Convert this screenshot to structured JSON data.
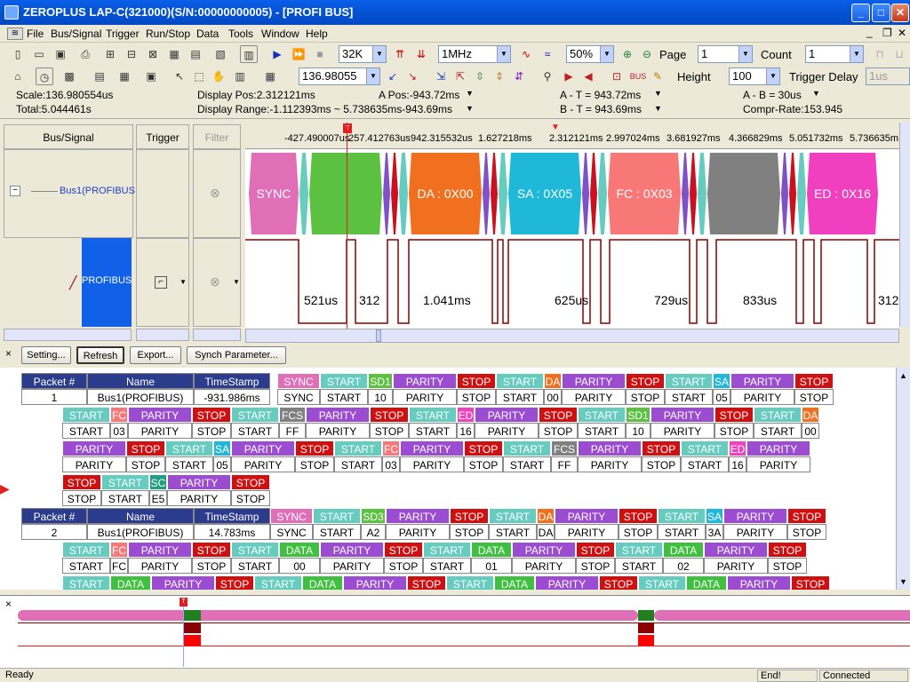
{
  "window": {
    "title": "ZEROPLUS LAP-C(321000)(S/N:00000000005) - [PROFI BUS]",
    "min": "_",
    "max": "□",
    "close": "✕"
  },
  "menu": [
    "File",
    "Bus/Signal",
    "Trigger",
    "Run/Stop",
    "Data",
    "Tools",
    "Window",
    "Help"
  ],
  "toolbar1": {
    "memory": "32K",
    "rate": "1MHz",
    "zoom": "50%",
    "page_label": "Page",
    "page": "1",
    "count_label": "Count",
    "count": "1"
  },
  "toolbar2": {
    "position": "136.98055",
    "height_label": "Height",
    "height": "100",
    "trigger_delay_label": "Trigger Delay",
    "delay_value": "1us"
  },
  "info": {
    "scale": "Scale:136.980554us",
    "total": "Total:5.044461s",
    "display_pos": "Display Pos:2.312121ms",
    "display_range": "Display Range:-1.112393ms ~ 5.738635ms-943.69ms",
    "a_pos": "A Pos:-943.72ms",
    "a_t": "A - T = 943.72ms",
    "b_t": "B - T = 943.69ms",
    "a_b": "A - B = 30us",
    "compr": "Compr-Rate:153.945"
  },
  "columns": {
    "bus_signal": "Bus/Signal",
    "trigger": "Trigger",
    "filter": "Filter"
  },
  "signals": {
    "bus": "Bus1(PROFIBUS",
    "channel": "PROFIBUS"
  },
  "ruler": [
    "-427.490007us",
    "257.412763us",
    "942.315532us",
    "1.627218ms",
    "2.312121ms",
    "2.997024ms",
    "3.681927ms",
    "4.366829ms",
    "5.051732ms",
    "5.736635m"
  ],
  "bus_segments": [
    {
      "label": "SYNC",
      "color": "#e06fb8",
      "w": 56
    },
    {
      "label": "",
      "color": "#66ccc0",
      "w": 10
    },
    {
      "label": "",
      "color": "#5cc040",
      "w": 82
    },
    {
      "label": "",
      "color": "#8050c8",
      "w": 8
    },
    {
      "label": "",
      "color": "#cc1020",
      "w": 8
    },
    {
      "label": "",
      "color": "#66ccc0",
      "w": 10
    },
    {
      "label": "DA : 0X00",
      "color": "#f07020",
      "w": 82
    },
    {
      "label": "",
      "color": "#8050c8",
      "w": 8
    },
    {
      "label": "",
      "color": "#cc1020",
      "w": 8
    },
    {
      "label": "",
      "color": "#66ccc0",
      "w": 10
    },
    {
      "label": "SA : 0X05",
      "color": "#20b8d8",
      "w": 82
    },
    {
      "label": "",
      "color": "#8050c8",
      "w": 8
    },
    {
      "label": "",
      "color": "#cc1020",
      "w": 8
    },
    {
      "label": "",
      "color": "#66ccc0",
      "w": 10
    },
    {
      "label": "FC : 0X03",
      "color": "#f87878",
      "w": 82
    },
    {
      "label": "",
      "color": "#8050c8",
      "w": 8
    },
    {
      "label": "",
      "color": "#cc1020",
      "w": 8
    },
    {
      "label": "",
      "color": "#66ccc0",
      "w": 10
    },
    {
      "label": "",
      "color": "#808080",
      "w": 82
    },
    {
      "label": "",
      "color": "#8050c8",
      "w": 8
    },
    {
      "label": "",
      "color": "#cc1020",
      "w": 8
    },
    {
      "label": "",
      "color": "#66ccc0",
      "w": 10
    },
    {
      "label": "ED : 0X16",
      "color": "#f040c0",
      "w": 80
    }
  ],
  "durations": [
    "521us",
    "312",
    "1.041ms",
    "625us",
    "729us",
    "833us",
    "312"
  ],
  "buttons": {
    "setting": "Setting...",
    "refresh": "Refresh",
    "export": "Export...",
    "synch": "Synch Parameter..."
  },
  "packet_headers": {
    "packet": "Packet #",
    "name": "Name",
    "timestamp": "TimeStamp"
  },
  "packets": [
    {
      "num": "1",
      "name": "Bus1(PROFIBUS)",
      "ts": "-931.986ms"
    },
    {
      "num": "2",
      "name": "Bus1(PROFIBUS)",
      "ts": "14.783ms"
    }
  ],
  "rows": [
    [
      [
        "SYNC",
        "SYNC"
      ],
      [
        "START",
        "START"
      ],
      [
        "SD1",
        "10"
      ],
      [
        "PARITY",
        "PARITY"
      ],
      [
        "STOP",
        "STOP"
      ],
      [
        "START",
        "START"
      ],
      [
        "DA",
        "00"
      ],
      [
        "PARITY",
        "PARITY"
      ],
      [
        "STOP",
        "STOP"
      ],
      [
        "START",
        "START"
      ],
      [
        "SA",
        "05"
      ],
      [
        "PARITY",
        "PARITY"
      ],
      [
        "STOP",
        "STOP"
      ]
    ],
    [
      [
        "START",
        "START"
      ],
      [
        "FC",
        "03"
      ],
      [
        "PARITY",
        "PARITY"
      ],
      [
        "STOP",
        "STOP"
      ],
      [
        "START",
        "START"
      ],
      [
        "FCS",
        "FF"
      ],
      [
        "PARITY",
        "PARITY"
      ],
      [
        "STOP",
        "STOP"
      ],
      [
        "START",
        "START"
      ],
      [
        "ED",
        "16"
      ],
      [
        "PARITY",
        "PARITY"
      ],
      [
        "STOP",
        "STOP"
      ],
      [
        "START",
        "START"
      ],
      [
        "SD1",
        "10"
      ],
      [
        "PARITY",
        "PARITY"
      ],
      [
        "STOP",
        "STOP"
      ],
      [
        "START",
        "START"
      ],
      [
        "DA",
        "00"
      ]
    ],
    [
      [
        "PARITY",
        "PARITY"
      ],
      [
        "STOP",
        "STOP"
      ],
      [
        "START",
        "START"
      ],
      [
        "SA",
        "05"
      ],
      [
        "PARITY",
        "PARITY"
      ],
      [
        "STOP",
        "STOP"
      ],
      [
        "START",
        "START"
      ],
      [
        "FC",
        "03"
      ],
      [
        "PARITY",
        "PARITY"
      ],
      [
        "STOP",
        "STOP"
      ],
      [
        "START",
        "START"
      ],
      [
        "FCS",
        "FF"
      ],
      [
        "PARITY",
        "PARITY"
      ],
      [
        "STOP",
        "STOP"
      ],
      [
        "START",
        "START"
      ],
      [
        "ED",
        "16"
      ],
      [
        "PARITY",
        "PARITY"
      ]
    ],
    [
      [
        "STOP",
        "STOP"
      ],
      [
        "START",
        "START"
      ],
      [
        "SC",
        "E5"
      ],
      [
        "PARITY",
        "PARITY"
      ],
      [
        "STOP",
        "STOP"
      ]
    ],
    [
      [
        "SYNC",
        "SYNC"
      ],
      [
        "START",
        "START"
      ],
      [
        "SD3",
        "A2"
      ],
      [
        "PARITY",
        "PARITY"
      ],
      [
        "STOP",
        "STOP"
      ],
      [
        "START",
        "START"
      ],
      [
        "DA",
        "DA"
      ],
      [
        "PARITY",
        "PARITY"
      ],
      [
        "STOP",
        "STOP"
      ],
      [
        "START",
        "START"
      ],
      [
        "SA",
        "3A"
      ],
      [
        "PARITY",
        "PARITY"
      ],
      [
        "STOP",
        "STOP"
      ]
    ],
    [
      [
        "START",
        "START"
      ],
      [
        "FC",
        "FC"
      ],
      [
        "PARITY",
        "PARITY"
      ],
      [
        "STOP",
        "STOP"
      ],
      [
        "START",
        "START"
      ],
      [
        "DATA",
        "00"
      ],
      [
        "PARITY",
        "PARITY"
      ],
      [
        "STOP",
        "STOP"
      ],
      [
        "START",
        "START"
      ],
      [
        "DATA",
        "01"
      ],
      [
        "PARITY",
        "PARITY"
      ],
      [
        "STOP",
        "STOP"
      ],
      [
        "START",
        "START"
      ],
      [
        "DATA",
        "02"
      ],
      [
        "PARITY",
        "PARITY"
      ],
      [
        "STOP",
        "STOP"
      ]
    ],
    [
      [
        "START",
        ""
      ],
      [
        "DATA",
        ""
      ],
      [
        "PARITY",
        ""
      ],
      [
        "STOP",
        ""
      ],
      [
        "START",
        ""
      ],
      [
        "DATA",
        ""
      ],
      [
        "PARITY",
        ""
      ],
      [
        "STOP",
        ""
      ],
      [
        "START",
        ""
      ],
      [
        "DATA",
        ""
      ],
      [
        "PARITY",
        ""
      ],
      [
        "STOP",
        ""
      ],
      [
        "START",
        ""
      ],
      [
        "DATA",
        ""
      ],
      [
        "PARITY",
        ""
      ],
      [
        "STOP",
        ""
      ]
    ]
  ],
  "field_colors": {
    "SYNC": "#e06fb8",
    "START": "#66ccc0",
    "PARITY": "#9c4cd0",
    "STOP": "#d01010",
    "SD1": "#5cc040",
    "SD3": "#5cc040",
    "DA": "#f07020",
    "SA": "#20b8d8",
    "FC": "#f87878",
    "FCS": "#808080",
    "ED": "#f040c0",
    "SC": "#20a080",
    "DATA": "#40c040"
  },
  "status": {
    "ready": "Ready",
    "end": "End!",
    "connected": "Connected"
  }
}
